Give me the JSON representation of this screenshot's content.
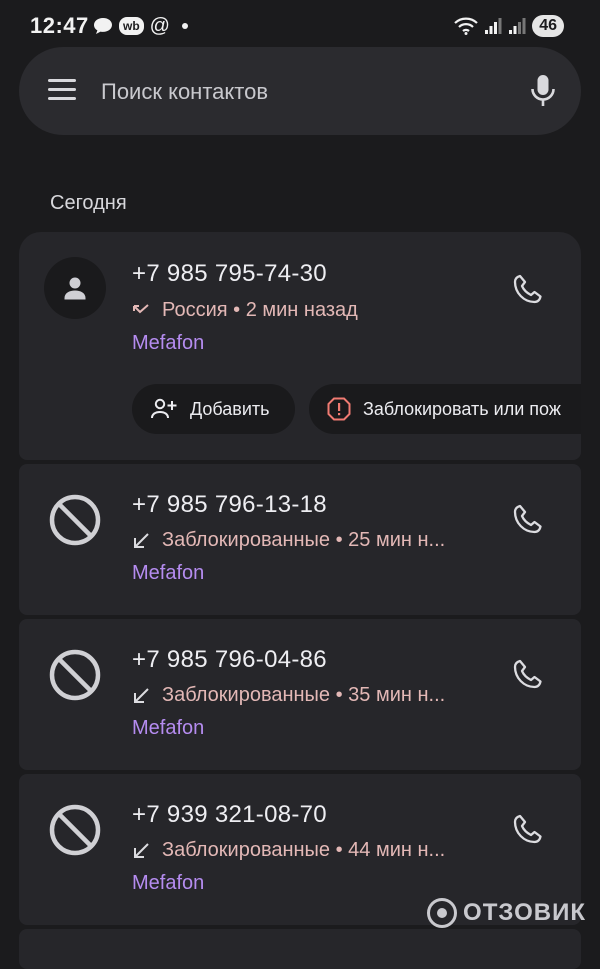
{
  "status_bar": {
    "time": "12:47",
    "app_badge": "wb",
    "at_sign": "@",
    "battery": "46"
  },
  "search": {
    "placeholder": "Поиск контактов"
  },
  "section": {
    "title": "Сегодня"
  },
  "calls": [
    {
      "number": "+7 985 795-74-30",
      "detail": "Россия • 2 мин назад",
      "carrier": "Mefafon",
      "type": "missed",
      "actions": {
        "add_label": "Добавить",
        "block_label": "Заблокировать или пож"
      }
    },
    {
      "number": "+7 985 796-13-18",
      "detail": "Заблокированные • 25 мин н...",
      "carrier": "Mefafon",
      "type": "blocked"
    },
    {
      "number": "+7 985 796-04-86",
      "detail": "Заблокированные • 35 мин н...",
      "carrier": "Mefafon",
      "type": "blocked"
    },
    {
      "number": "+7 939 321-08-70",
      "detail": "Заблокированные • 44 мин н...",
      "carrier": "Mefafon",
      "type": "blocked"
    }
  ],
  "watermark": "ОТЗОВИК",
  "colors": {
    "background": "#1b1b1d",
    "card": "#26262a",
    "detail_text": "#e3b8b6",
    "carrier_text": "#b58cf0",
    "block_warning": "#f07b72"
  },
  "icons": {
    "menu": "menu-icon",
    "mic": "mic-icon",
    "call": "phone-icon",
    "blocked": "block-icon",
    "missed": "missed-call-icon",
    "incoming": "incoming-arrow-icon",
    "add_contact": "add-person-icon",
    "warning": "warning-icon"
  }
}
